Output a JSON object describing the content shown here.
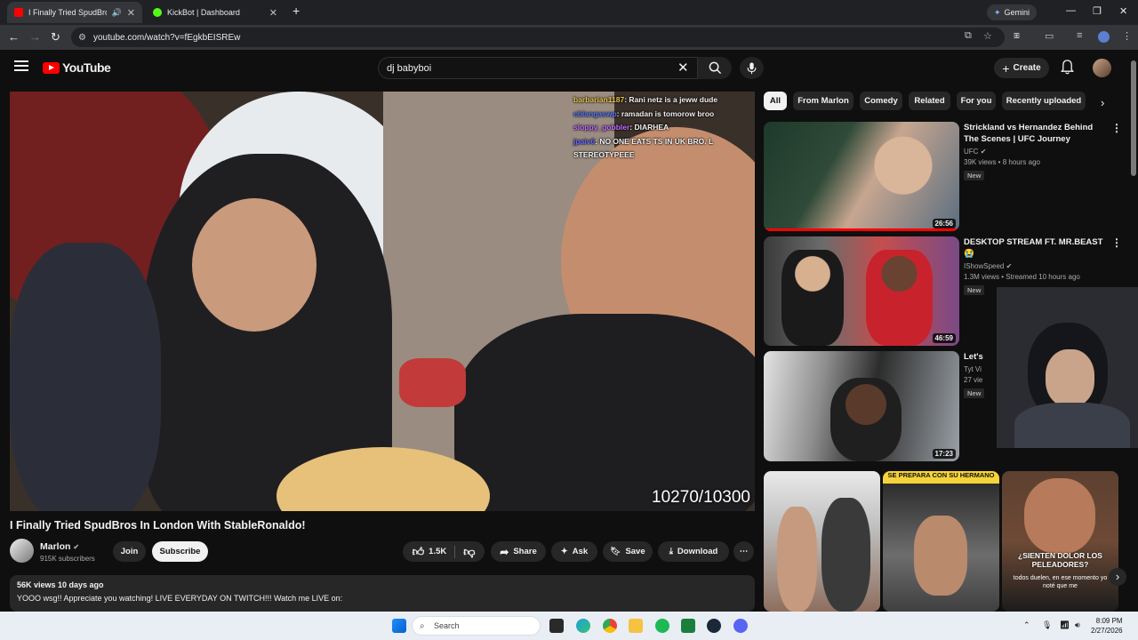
{
  "browser": {
    "tabs": [
      {
        "title": "I Finally Tried SpudBros In L",
        "active": true
      },
      {
        "title": "KickBot | Dashboard",
        "active": false
      }
    ],
    "new_tab": "+",
    "gemini_label": "Gemini",
    "url": "youtube.com/watch?v=fEgkbEISREw"
  },
  "youtube": {
    "logo_text": "YouTube",
    "search_value": "dj babyboi",
    "create_label": "Create",
    "video": {
      "chat": [
        {
          "user": "barbarian1187",
          "msg": "Rani netz is a jeww dude",
          "color": "#e6c34a"
        },
        {
          "user": "cblangaswp",
          "msg": "ramadan is tomorow broo",
          "color": "#5a7cff"
        },
        {
          "user": "sloppy_gobbler",
          "msg": "DIARHEA",
          "color": "#c070ff"
        },
        {
          "user": "jpaiv6",
          "msg": "NO ONE EATS TS IN UK BRO. L STEREOTYPEEE",
          "color": "#6a6aff"
        }
      ],
      "overlay_count": "10270/10300",
      "title": "I Finally Tried SpudBros In London With StableRonaldo!",
      "channel": "Marlon",
      "subscribers": "915K subscribers",
      "join_label": "Join",
      "subscribe_label": "Subscribe",
      "likes": "1.5K",
      "share_label": "Share",
      "ask_label": "Ask",
      "save_label": "Save",
      "download_label": "Download",
      "views_date": "56K views  10 days ago",
      "description": "YOOO wsg!! Appreciate you watching! LIVE EVERYDAY ON TWITCH!!! Watch me LIVE on:"
    },
    "chips": [
      "All",
      "From Marlon",
      "Comedy",
      "Related",
      "For you",
      "Recently uploaded"
    ],
    "recommended": [
      {
        "title": "Strickland vs Hernandez Behind The Scenes | UFC Journey",
        "channel": "UFC",
        "info": "39K views • 8 hours ago",
        "badge": "New",
        "duration": "26:56"
      },
      {
        "title": "DESKTOP STREAM FT. MR.BEAST 😭",
        "channel": "IShowSpeed",
        "info": "1.3M views • Streamed 10 hours ago",
        "badge": "New",
        "duration": "46:59"
      },
      {
        "title": "Let's",
        "channel": "Tyt Vi",
        "info": "27 vie",
        "badge": "New",
        "duration": "17:23"
      }
    ],
    "shorts": [
      {
        "caption": ""
      },
      {
        "caption": "SE PREPARA CON SU HERMANO"
      },
      {
        "caption": "¿SIENTEN DOLOR LOS PELEADORES?",
        "sub": "todos duelen, en ese momento yo noté que me"
      }
    ]
  },
  "taskbar": {
    "search_placeholder": "Search",
    "time": "8:09 PM",
    "date": "2/27/2026"
  }
}
